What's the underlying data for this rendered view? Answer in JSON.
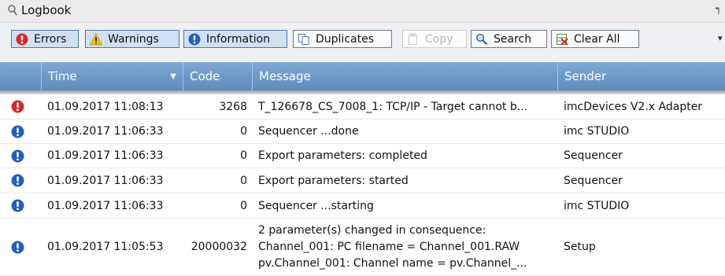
{
  "window": {
    "title": "Logbook",
    "pin_glyph": "┑"
  },
  "toolbar": {
    "buttons": [
      {
        "label": "Errors",
        "icon": "error-icon"
      },
      {
        "label": "Warnings",
        "icon": "warning-icon"
      },
      {
        "label": "Information",
        "icon": "information-icon"
      },
      {
        "label": "Duplicates",
        "icon": "duplicates-icon"
      },
      {
        "label": "Copy",
        "icon": "copy-icon"
      },
      {
        "label": "Search",
        "icon": "search-icon"
      },
      {
        "label": "Clear All",
        "icon": "clear-all-icon"
      }
    ],
    "more_glyph": "▾"
  },
  "grid": {
    "columns": [
      "",
      "Time",
      "Code",
      "Message",
      "Sender"
    ],
    "sort_glyph": "▼",
    "rows": [
      {
        "level": "error",
        "time": "01.09.2017 11:08:13",
        "code": "3268",
        "message": "T_126678_CS_7008_1: TCP/IP - Target cannot b...",
        "sender": "imcDevices V2.x Adapter"
      },
      {
        "level": "info",
        "time": "01.09.2017 11:06:33",
        "code": "0",
        "message": "Sequencer ...done",
        "sender": "imc STUDIO"
      },
      {
        "level": "info",
        "time": "01.09.2017 11:06:33",
        "code": "0",
        "message": "Export parameters: completed",
        "sender": "Sequencer"
      },
      {
        "level": "info",
        "time": "01.09.2017 11:06:33",
        "code": "0",
        "message": "Export parameters: started",
        "sender": "Sequencer"
      },
      {
        "level": "info",
        "time": "01.09.2017 11:06:33",
        "code": "0",
        "message": "Sequencer ...starting",
        "sender": "imc STUDIO"
      },
      {
        "level": "info",
        "time": "01.09.2017 11:05:53",
        "code": "20000032",
        "message": "2 parameter(s) changed in consequence:\nChannel_001: PC filename = Channel_001.RAW\npv.Channel_001: Channel name = pv.Channel_...",
        "sender": "Setup"
      }
    ]
  },
  "colors": {
    "header_bg": "#6a96c8",
    "error_red": "#d9262b",
    "info_blue": "#1f5fbf",
    "warning_yellow": "#f2c40c",
    "active_button": "#cfe0f2"
  }
}
